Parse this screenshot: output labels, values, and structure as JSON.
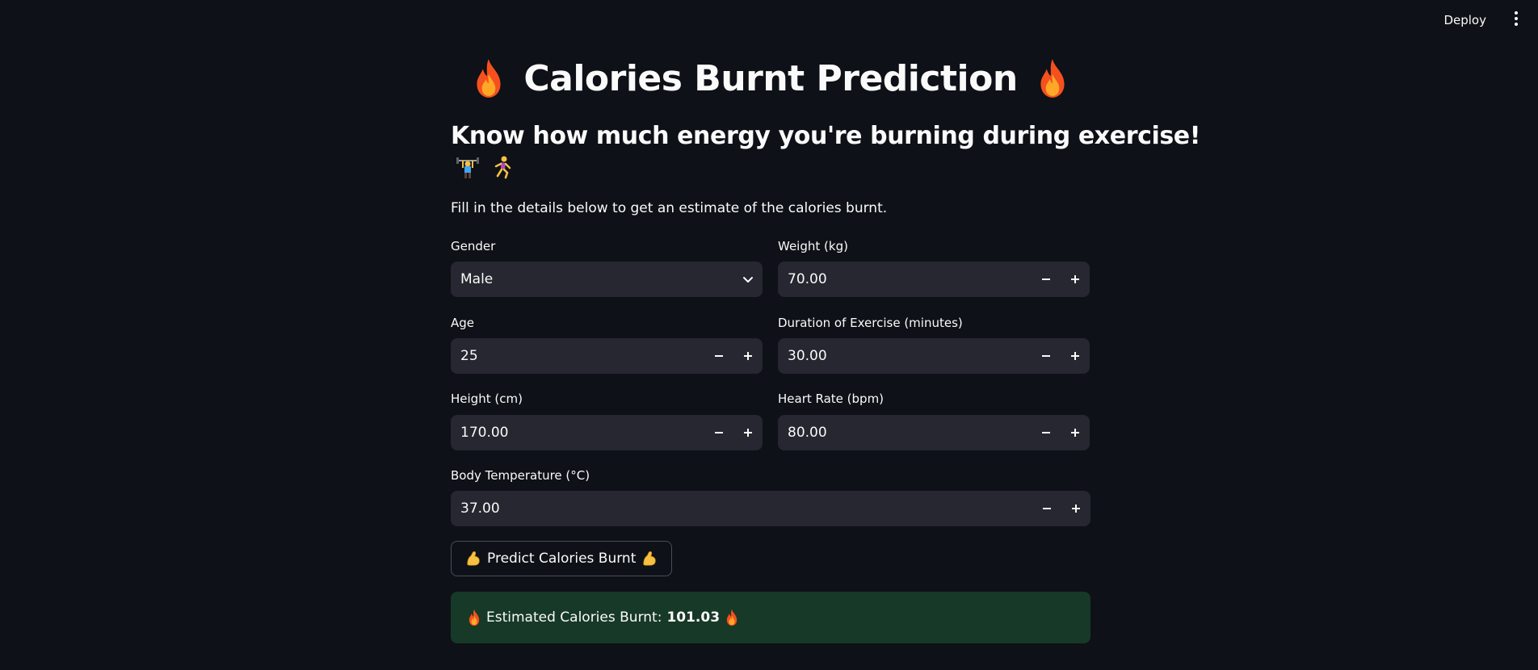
{
  "header": {
    "deploy_label": "Deploy",
    "menu_icon": "kebab-menu-icon"
  },
  "page": {
    "title": "Calories Burnt Prediction",
    "title_icons": [
      "fire-icon",
      "fire-icon"
    ],
    "subtitle": "Know how much energy you're burning during exercise!",
    "subtitle_icons": [
      "weightlifter-icon",
      "runner-icon"
    ],
    "description": "Fill in the details below to get an estimate of the calories burnt."
  },
  "form": {
    "gender": {
      "label": "Gender",
      "value": "Male"
    },
    "weight": {
      "label": "Weight (kg)",
      "value": "70.00"
    },
    "age": {
      "label": "Age",
      "value": "25"
    },
    "duration": {
      "label": "Duration of Exercise (minutes)",
      "value": "30.00"
    },
    "height": {
      "label": "Height (cm)",
      "value": "170.00"
    },
    "heart_rate": {
      "label": "Heart Rate (bpm)",
      "value": "80.00"
    },
    "body_temp": {
      "label": "Body Temperature (°C)",
      "value": "37.00"
    }
  },
  "predict_button": {
    "label": "Predict Calories Burnt",
    "icon": "flexed-biceps-icon"
  },
  "result": {
    "label": "Estimated Calories Burnt:",
    "value": "101.03",
    "icon": "fire-icon"
  },
  "colors": {
    "background": "#0e1117",
    "input_bg": "#262730",
    "success_bg": "#173928",
    "text": "#fafafa"
  }
}
